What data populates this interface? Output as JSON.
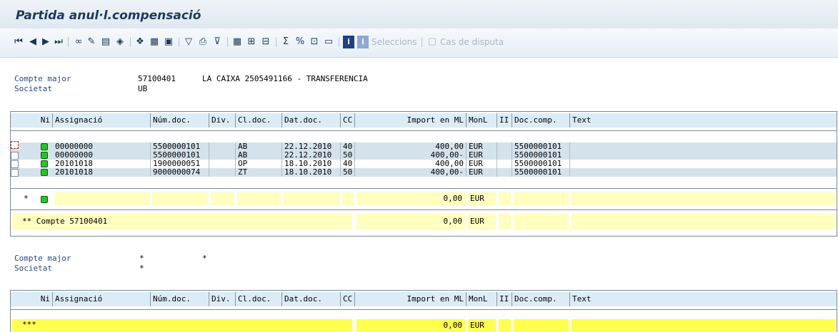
{
  "window": {
    "title": "Partida anul·l.compensació"
  },
  "toolbar": {
    "icons": [
      "first-page-icon",
      "previous-page-icon",
      "next-page-icon",
      "last-page-icon",
      "glasses-icon",
      "pencil-icon",
      "select-layout-icon",
      "save-layout-icon",
      "details-icon",
      "change-layout-icon",
      "choose-icon",
      "filter-icon",
      "print-icon",
      "sort-icon",
      "grid-icon",
      "insert-col-icon",
      "delete-col-icon",
      "totals-icon",
      "subtotals-icon",
      "export-icon",
      "mail-icon",
      "info-icon",
      "info-alt-icon",
      "document-icon"
    ],
    "selections_label": "Seleccions",
    "dispute_label": "Cas de disputa"
  },
  "account1": {
    "compte_major_label": "Compte major",
    "compte_major_value": "57100401",
    "compte_major_desc": "LA CAIXA 2505491166 - TRANSFERENCIA",
    "societat_label": "Societat",
    "societat_value": "UB"
  },
  "columns": [
    "Ni",
    "Assignació",
    "Núm.doc.",
    "Div.",
    "Cl.doc.",
    "Dat.doc.",
    "CC",
    "Import en ML",
    "MonL",
    "II",
    "Doc.comp.",
    "Text"
  ],
  "rows": [
    {
      "assign": "00000000",
      "numdoc": "5500000101",
      "div": "",
      "cldoc": "AB",
      "date": "22.12.2010",
      "cc": "40",
      "import": "400,00",
      "monl": "EUR",
      "ii": "",
      "doccomp": "5500000101",
      "text": ""
    },
    {
      "assign": "00000000",
      "numdoc": "5500000101",
      "div": "",
      "cldoc": "AB",
      "date": "22.12.2010",
      "cc": "50",
      "import": "400,00-",
      "monl": "EUR",
      "ii": "",
      "doccomp": "5500000101",
      "text": ""
    },
    {
      "assign": "20101018",
      "numdoc": "1900000051",
      "div": "",
      "cldoc": "OP",
      "date": "18.10.2010",
      "cc": "40",
      "import": "400,00",
      "monl": "EUR",
      "ii": "",
      "doccomp": "5500000101",
      "text": ""
    },
    {
      "assign": "20101018",
      "numdoc": "9000000074",
      "div": "",
      "cldoc": "ZT",
      "date": "18.10.2010",
      "cc": "50",
      "import": "400,00-",
      "monl": "EUR",
      "ii": "",
      "doccomp": "5500000101",
      "text": ""
    }
  ],
  "total": {
    "marker": "*",
    "import": "0,00",
    "monl": "EUR"
  },
  "account_total": {
    "label": "** Compte 57100401",
    "import": "0,00",
    "monl": "EUR"
  },
  "account2": {
    "compte_major_label": "Compte major",
    "compte_major_value": "*",
    "compte_major_desc": "*",
    "societat_label": "Societat",
    "societat_value": "*"
  },
  "grand_total": {
    "label": "***",
    "import": "0,00",
    "monl": "EUR"
  },
  "colors": {
    "rowA": "#d4e2ec",
    "rowB": "#ffffff",
    "sumYellow": "#ffffc0",
    "grandYellow": "#ffff50",
    "lamp": "#27c427"
  }
}
